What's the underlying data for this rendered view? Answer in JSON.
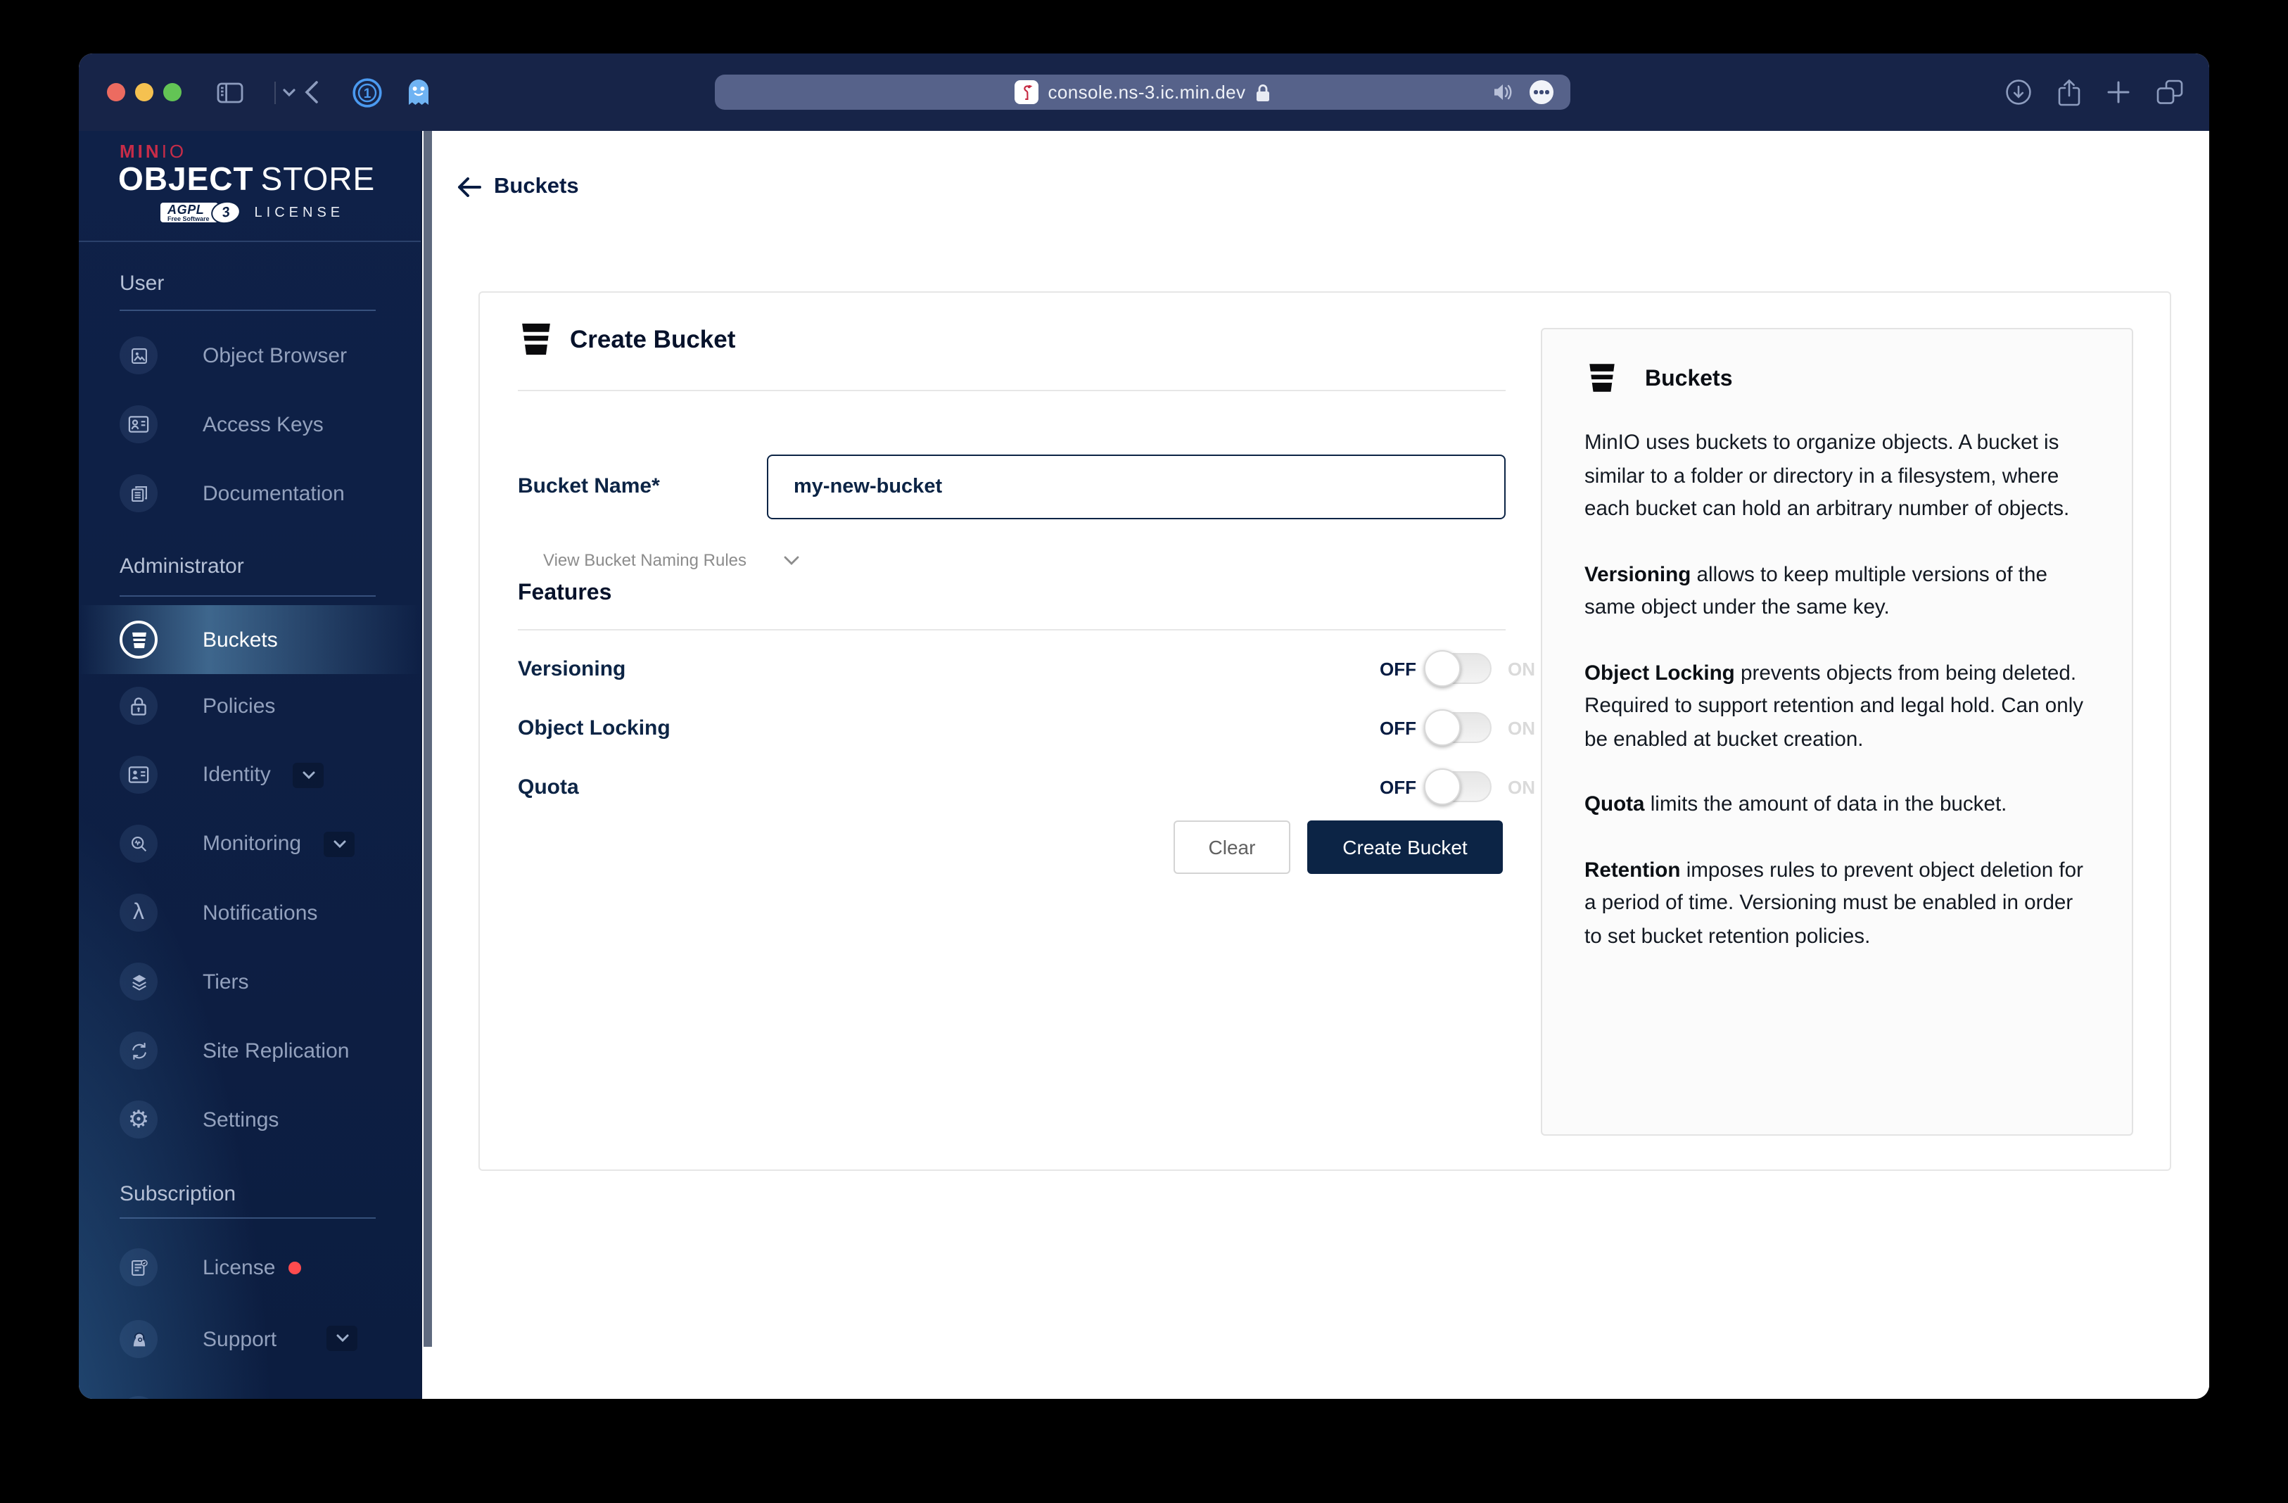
{
  "colors": {
    "brand_red": "#C72C48",
    "navy": "#0C2445",
    "chrome": "#172448",
    "sidebar_highlight": "#5E96BD",
    "license_alert": "#FF4B4E"
  },
  "browser": {
    "url": "console.ns-3.ic.min.dev"
  },
  "sidebar": {
    "logo": {
      "brand_bold": "MIN",
      "brand_light": "IO",
      "product_bold": "OBJECT",
      "product_light": "STORE",
      "badge_main": "AGPL",
      "badge_sub": "Free Software",
      "badge_version": "3",
      "license_label": "LICENSE"
    },
    "sections": {
      "user": "User",
      "administrator": "Administrator",
      "subscription": "Subscription"
    },
    "items": {
      "object_browser": "Object Browser",
      "access_keys": "Access Keys",
      "documentation": "Documentation",
      "buckets": "Buckets",
      "policies": "Policies",
      "identity": "Identity",
      "monitoring": "Monitoring",
      "notifications": "Notifications",
      "tiers": "Tiers",
      "site_replication": "Site Replication",
      "settings": "Settings",
      "license": "License",
      "support": "Support"
    }
  },
  "header": {
    "back_label": "Buckets"
  },
  "form": {
    "title": "Create Bucket",
    "bucket_name_label": "Bucket Name*",
    "bucket_name_value": "my-new-bucket",
    "naming_rules_label": "View Bucket Naming Rules",
    "features_title": "Features",
    "toggles": [
      {
        "label": "Versioning",
        "off": "OFF",
        "on": "ON"
      },
      {
        "label": "Object Locking",
        "off": "OFF",
        "on": "ON"
      },
      {
        "label": "Quota",
        "off": "OFF",
        "on": "ON"
      }
    ],
    "clear_label": "Clear",
    "submit_label": "Create Bucket"
  },
  "info_panel": {
    "title": "Buckets",
    "paragraphs": [
      {
        "lead": "",
        "text": "MinIO uses buckets to organize objects. A bucket is similar to a folder or directory in a filesystem, where each bucket can hold an arbitrary number of objects."
      },
      {
        "lead": "Versioning",
        "text": " allows to keep multiple versions of the same object under the same key."
      },
      {
        "lead": "Object Locking",
        "text": " prevents objects from being deleted. Required to support retention and legal hold. Can only be enabled at bucket creation."
      },
      {
        "lead": "Quota",
        "text": " limits the amount of data in the bucket."
      },
      {
        "lead": "Retention",
        "text": " imposes rules to prevent object deletion for a period of time. Versioning must be enabled in order to set bucket retention policies."
      }
    ]
  }
}
